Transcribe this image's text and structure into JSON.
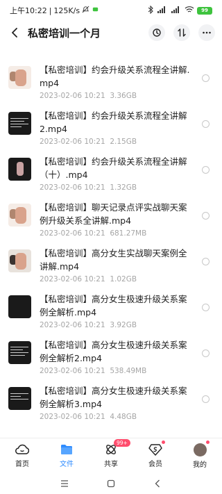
{
  "status_bar": {
    "time": "上午10:22",
    "speed": "125K/s",
    "battery": "99"
  },
  "header": {
    "title": "私密培训一个月"
  },
  "files": [
    {
      "name": "【私密培训】约会升级关系流程全讲解.mp4",
      "date": "2023-02-06  10:21",
      "size": "3.36GB",
      "thumb": "light"
    },
    {
      "name": "【私密培训】约会升级关系流程全讲解2.mp4",
      "date": "2023-02-06  10:21",
      "size": "2.15GB",
      "thumb": "dark"
    },
    {
      "name": "【私密培训】约会升级关系流程全讲解（十）.mp4",
      "date": "2023-02-06  10:21",
      "size": "1.32GB",
      "thumb": "dark"
    },
    {
      "name": "【私密培训】聊天记录点评实战聊天案例升级关系全讲解.mp4",
      "date": "2023-02-06  10:21",
      "size": "681.27MB",
      "thumb": "light"
    },
    {
      "name": "【私密培训】高分女生实战聊天案例全讲解.mp4",
      "date": "2023-02-06  10:21",
      "size": "1.02GB",
      "thumb": "light"
    },
    {
      "name": "【私密培训】高分女生极速升级关系案例全解析.mp4",
      "date": "2023-02-06  10:21",
      "size": "3.92GB",
      "thumb": "dark"
    },
    {
      "name": "【私密培训】高分女生极速升级关系案例全解析2.mp4",
      "date": "2023-02-06  10:21",
      "size": "538.49MB",
      "thumb": "dark"
    },
    {
      "name": "【私密培训】高分女生极速升级关系案例全解析3.mp4",
      "date": "2023-02-06  10:21",
      "size": "4.48GB",
      "thumb": "dark"
    }
  ],
  "tabs": [
    {
      "label": "首页",
      "icon": "cloud-icon"
    },
    {
      "label": "文件",
      "icon": "folder-icon",
      "active": true
    },
    {
      "label": "共享",
      "icon": "share-icon",
      "badge": "99+"
    },
    {
      "label": "会员",
      "icon": "vip-icon",
      "dot": true
    },
    {
      "label": "我的",
      "icon": "avatar-icon",
      "dot": true
    }
  ],
  "colors": {
    "accent": "#2f8cff",
    "badge": "#ff4d6d",
    "meta_text": "#a5a5a5"
  }
}
